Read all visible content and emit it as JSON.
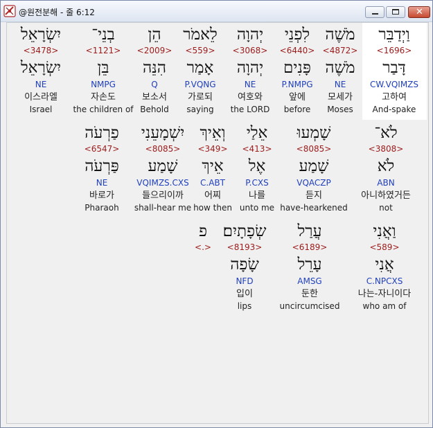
{
  "window": {
    "title": "@원전분해 - 줄 6:12",
    "minimize_icon": "minimize-icon",
    "maximize_icon": "maximize-icon",
    "close_icon": "close-icon",
    "close_glyph": "✕"
  },
  "colors": {
    "strong": "#9b1b1b",
    "morph": "#1f3fbd",
    "selected_bg": "#ffffff"
  },
  "rows": [
    {
      "words": [
        {
          "heb": "וַיְדַבֵּר",
          "strong": "<1696>",
          "lemma": "דָּבַר",
          "morph": "CW.VQIMZS",
          "kor": "고하여",
          "eng": "And-spake"
        },
        {
          "heb": "מֹשֶׁה",
          "strong": "<4872>",
          "lemma": "מֹשֶׁה",
          "morph": "NE",
          "kor": "모세가",
          "eng": "Moses"
        },
        {
          "heb": "לִפְנֵי",
          "strong": "<6440>",
          "lemma": "פָּנִים",
          "morph": "P.NMPG",
          "kor": "앞에",
          "eng": "before"
        },
        {
          "heb": "יְהוָה",
          "strong": "<3068>",
          "lemma": "יְהוָה",
          "morph": "NE",
          "kor": "여호와",
          "eng": "the LORD"
        },
        {
          "heb": "לֵאמֹר",
          "strong": "<559>",
          "lemma": "אָמַר",
          "morph": "P.VQNG",
          "kor": "가로되",
          "eng": "saying"
        },
        {
          "heb": "הֵן",
          "strong": "<2009>",
          "lemma": "הִנֵּה",
          "morph": "Q",
          "kor": "보소서",
          "eng": "Behold"
        },
        {
          "heb": "בְנֵי־",
          "strong": "<1121>",
          "lemma": "בֵּן",
          "morph": "NMPG",
          "kor": "자손도",
          "eng": "the children of"
        },
        {
          "heb": "יִשְׂרָאֵל",
          "strong": "<3478>",
          "lemma": "יִשְׂרָאֵל",
          "morph": "NE",
          "kor": "이스라엘",
          "eng": "Israel"
        }
      ]
    },
    {
      "words": [
        {
          "heb": "לֹא־",
          "strong": "<3808>",
          "lemma": "לֹא",
          "morph": "ABN",
          "kor": "아니하였거든",
          "eng": "not"
        },
        {
          "heb": "שָׁמְעוּ",
          "strong": "<8085>",
          "lemma": "שָׁמַע",
          "morph": "VQACZP",
          "kor": "듣지",
          "eng": "have-hearkened"
        },
        {
          "heb": "אֵלַי",
          "strong": "<413>",
          "lemma": "אֶל",
          "morph": "P.CXS",
          "kor": "나를",
          "eng": "unto me"
        },
        {
          "heb": "וְאֵיךְ",
          "strong": "<349>",
          "lemma": "אֵיךְ",
          "morph": "C.ABT",
          "kor": "어찌",
          "eng": "how then"
        },
        {
          "heb": "יִשְׁמָעֵנִי",
          "strong": "<8085>",
          "lemma": "שָׁמַע",
          "morph": "VQIMZS.CXS",
          "kor": "들으리이까",
          "eng": "shall-hear me"
        },
        {
          "heb": "פַרְעֹה",
          "strong": "<6547>",
          "lemma": "פַּרְעֹה",
          "morph": "NE",
          "kor": "바로가",
          "eng": "Pharaoh"
        }
      ]
    },
    {
      "words": [
        {
          "heb": "וַאֲנִי",
          "strong": "<589>",
          "lemma": "אֲנִי",
          "morph": "C.NPCXS",
          "kor": "나는-자니이다",
          "eng": "who am of"
        },
        {
          "heb": "עֲרַל",
          "strong": "<6189>",
          "lemma": "עָרֵל",
          "morph": "AMSG",
          "kor": "둔한",
          "eng": "uncircumcised"
        },
        {
          "heb": "שְׂפָתָיִם׃",
          "strong": "<8193>",
          "lemma": "שָׂפָה",
          "morph": "NFD",
          "kor": "입이",
          "eng": "lips"
        },
        {
          "heb": "פ",
          "strong": "<.>",
          "lemma": "",
          "morph": "",
          "kor": "",
          "eng": ""
        }
      ]
    }
  ]
}
